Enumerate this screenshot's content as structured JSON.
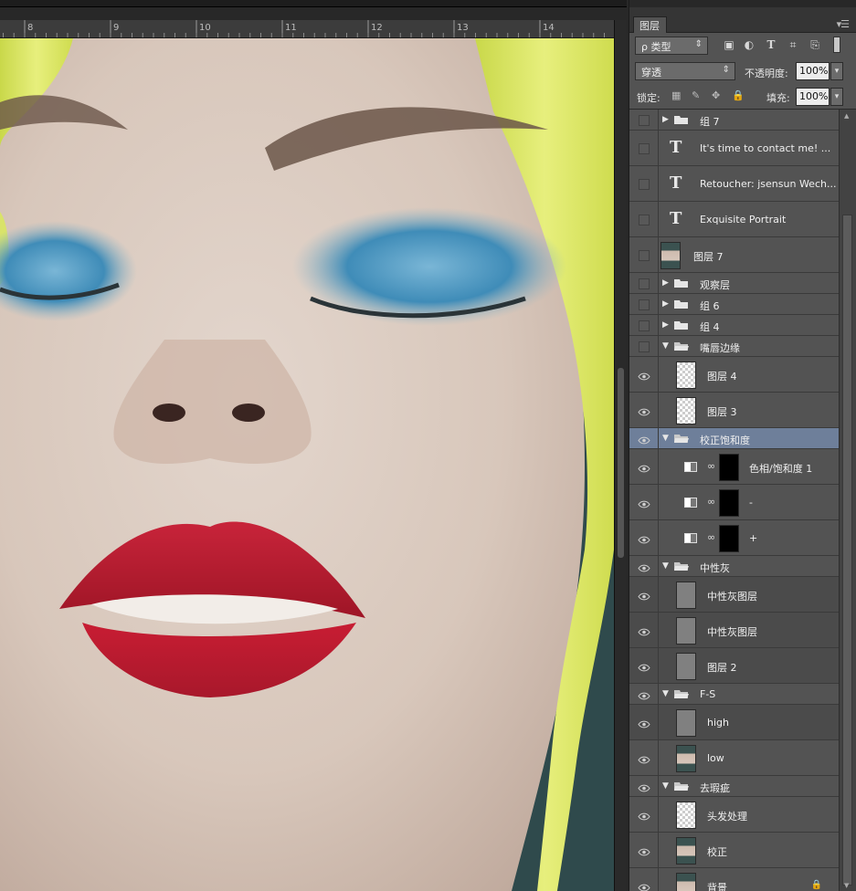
{
  "ruler": {
    "ticks": [
      "8",
      "9",
      "10",
      "11",
      "12",
      "13",
      "14"
    ]
  },
  "panel": {
    "tab_label": "图层",
    "menu_glyph": "▾☰",
    "filter": {
      "kind_label": "ρ 类型",
      "icons": [
        "image-filter-icon",
        "adjustment-filter-icon",
        "type-filter-icon",
        "shape-filter-icon",
        "smart-object-filter-icon"
      ]
    },
    "blend_mode": "穿透",
    "opacity_label": "不透明度:",
    "opacity_value": "100%",
    "lock_label": "锁定:",
    "fill_label": "填充:",
    "fill_value": "100%"
  },
  "layers": [
    {
      "name": "组 7",
      "kind": "group",
      "visible": false,
      "expanded": false
    },
    {
      "name": "It's time to contact me! ...",
      "kind": "text",
      "visible": false
    },
    {
      "name": "Retoucher: jsensun Wech...",
      "kind": "text",
      "visible": false
    },
    {
      "name": "Exquisite Portrait",
      "kind": "text",
      "visible": false
    },
    {
      "name": "图层 7",
      "kind": "photo",
      "visible": false
    },
    {
      "name": "观察层",
      "kind": "group",
      "visible": false,
      "expanded": false
    },
    {
      "name": "组 6",
      "kind": "group",
      "visible": false,
      "expanded": false
    },
    {
      "name": "组 4",
      "kind": "group",
      "visible": false,
      "expanded": false
    },
    {
      "name": "嘴唇边缘",
      "kind": "group",
      "visible": false,
      "expanded": true
    },
    {
      "name": "图层 4",
      "kind": "transparent",
      "visible": true
    },
    {
      "name": "图层 3",
      "kind": "transparent",
      "visible": true
    },
    {
      "name": "校正饱和度",
      "kind": "group",
      "visible": true,
      "expanded": true,
      "selected": true
    },
    {
      "name": "色相/饱和度 1",
      "kind": "adjustment",
      "visible": true
    },
    {
      "name": "-",
      "kind": "adjustment",
      "visible": true
    },
    {
      "name": "+",
      "kind": "adjustment",
      "visible": true
    },
    {
      "name": "中性灰",
      "kind": "group",
      "visible": true,
      "expanded": true
    },
    {
      "name": "中性灰图层",
      "kind": "gray",
      "visible": true
    },
    {
      "name": "中性灰图层",
      "kind": "gray",
      "visible": true
    },
    {
      "name": "图层 2",
      "kind": "gray",
      "visible": true
    },
    {
      "name": "F-S",
      "kind": "group",
      "visible": true,
      "expanded": true
    },
    {
      "name": "high",
      "kind": "gray",
      "visible": true
    },
    {
      "name": "low",
      "kind": "photo",
      "visible": true
    },
    {
      "name": "去瑕疵",
      "kind": "group",
      "visible": true,
      "expanded": true
    },
    {
      "name": "头发处理",
      "kind": "transparent",
      "visible": true
    },
    {
      "name": "校正",
      "kind": "photo",
      "visible": true
    },
    {
      "name": "背景",
      "kind": "photo",
      "visible": true,
      "locked": true
    }
  ]
}
